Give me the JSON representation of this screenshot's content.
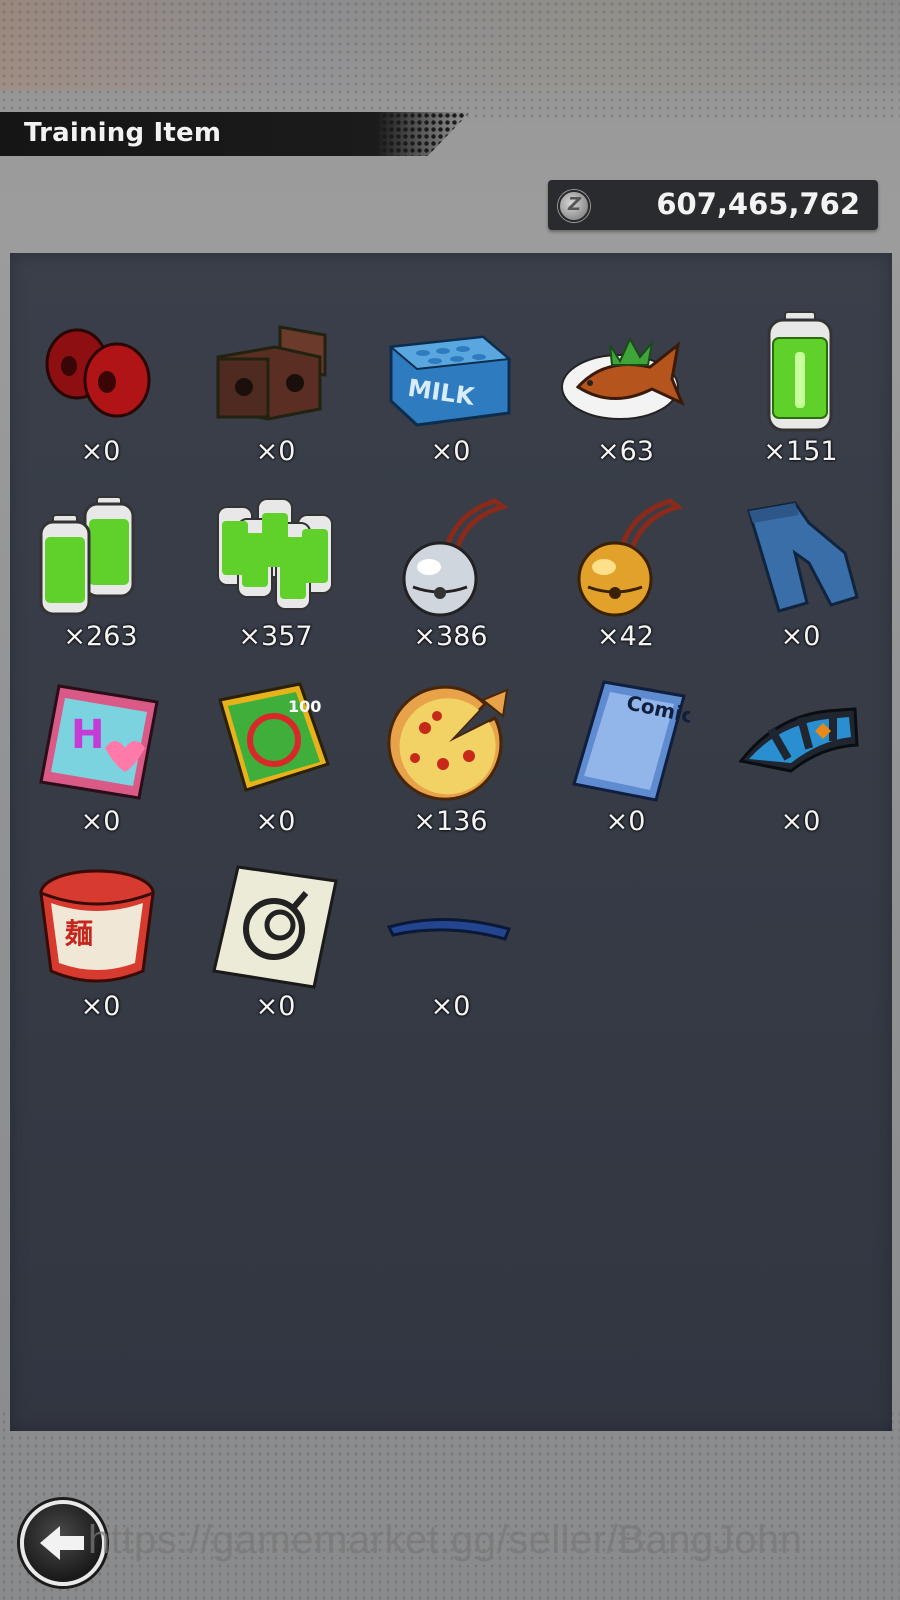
{
  "header": {
    "title": "Training Item"
  },
  "currency": {
    "icon": "zeni-coin-icon",
    "value": "607,465,762"
  },
  "items": [
    {
      "name": "red-weights",
      "count": "×0"
    },
    {
      "name": "brick-weights",
      "count": "×0"
    },
    {
      "name": "milk-crate",
      "count": "×0"
    },
    {
      "name": "grilled-fish",
      "count": "×63"
    },
    {
      "name": "energy-battery-single",
      "count": "×151"
    },
    {
      "name": "energy-battery-double",
      "count": "×263"
    },
    {
      "name": "energy-battery-pack",
      "count": "×357"
    },
    {
      "name": "silver-bell",
      "count": "×386"
    },
    {
      "name": "gold-bell",
      "count": "×42"
    },
    {
      "name": "jeans",
      "count": "×0"
    },
    {
      "name": "romance-manga",
      "count": "×0"
    },
    {
      "name": "comedy-book",
      "count": "×0"
    },
    {
      "name": "pizza",
      "count": "×136"
    },
    {
      "name": "comic-magazine",
      "count": "×0"
    },
    {
      "name": "saiyan-wristband",
      "count": "×0"
    },
    {
      "name": "cup-noodle",
      "count": "×0"
    },
    {
      "name": "capsule-corp-card",
      "count": "×0"
    },
    {
      "name": "blue-headband",
      "count": "×0"
    }
  ],
  "watermark": "https://gamemarket.gg/seller/BangJohn",
  "colors": {
    "panel": "#363b46",
    "title_bar": "#1b1b1b",
    "text": "#f4f4f4"
  }
}
